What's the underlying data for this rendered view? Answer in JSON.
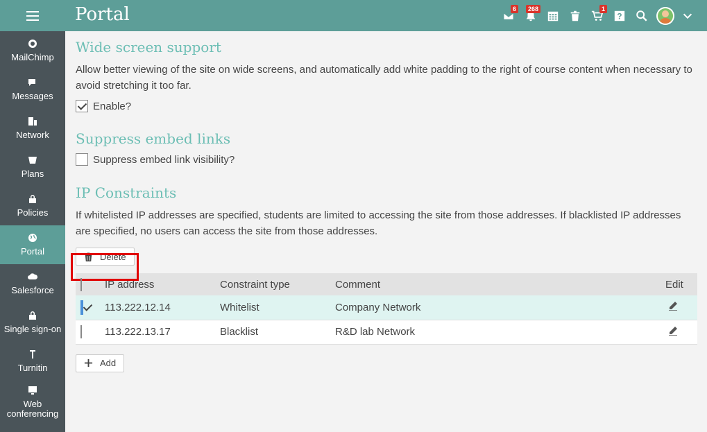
{
  "header": {
    "title": "Portal",
    "badges": {
      "messages": "6",
      "notifications": "268",
      "cart": "1"
    }
  },
  "sidebar": {
    "items": [
      {
        "label": "MailChimp",
        "icon": "mailchimp-icon"
      },
      {
        "label": "Messages",
        "icon": "chat-icon"
      },
      {
        "label": "Network",
        "icon": "building-icon"
      },
      {
        "label": "Plans",
        "icon": "plans-icon"
      },
      {
        "label": "Policies",
        "icon": "lock-icon"
      },
      {
        "label": "Portal",
        "icon": "globe-icon",
        "active": true
      },
      {
        "label": "Salesforce",
        "icon": "cloud-icon"
      },
      {
        "label": "Single sign-on",
        "icon": "sso-lock-icon"
      },
      {
        "label": "Turnitin",
        "icon": "turnitin-icon"
      },
      {
        "label": "Web conferencing",
        "icon": "monitor-icon"
      }
    ]
  },
  "wide_screen": {
    "title": "Wide screen support",
    "description": "Allow better viewing of the site on wide screens, and automatically add white padding to the right of course content when necessary to avoid stretching it too far.",
    "enable_label": "Enable?",
    "enabled": true
  },
  "suppress_embed": {
    "title": "Suppress embed links",
    "checkbox_label": "Suppress embed link visibility?",
    "checked": false
  },
  "ip_constraints": {
    "title": "IP Constraints",
    "description": "If whitelisted IP addresses are specified, students are limited to accessing the site from those addresses. If blacklisted IP addresses are specified, no users can access the site from those addresses.",
    "delete_label": "Delete",
    "add_label": "Add",
    "columns": [
      "IP address",
      "Constraint type",
      "Comment",
      "Edit"
    ],
    "rows": [
      {
        "ip": "113.222.12.14",
        "type": "Whitelist",
        "comment": "Company Network",
        "selected": true
      },
      {
        "ip": "113.222.13.17",
        "type": "Blacklist",
        "comment": "R&D lab Network",
        "selected": false
      }
    ]
  },
  "colors": {
    "topbar": "#5d9e98",
    "sidebar": "#4a5459",
    "heading": "#6cbeb4",
    "highlight": "#e10000"
  }
}
